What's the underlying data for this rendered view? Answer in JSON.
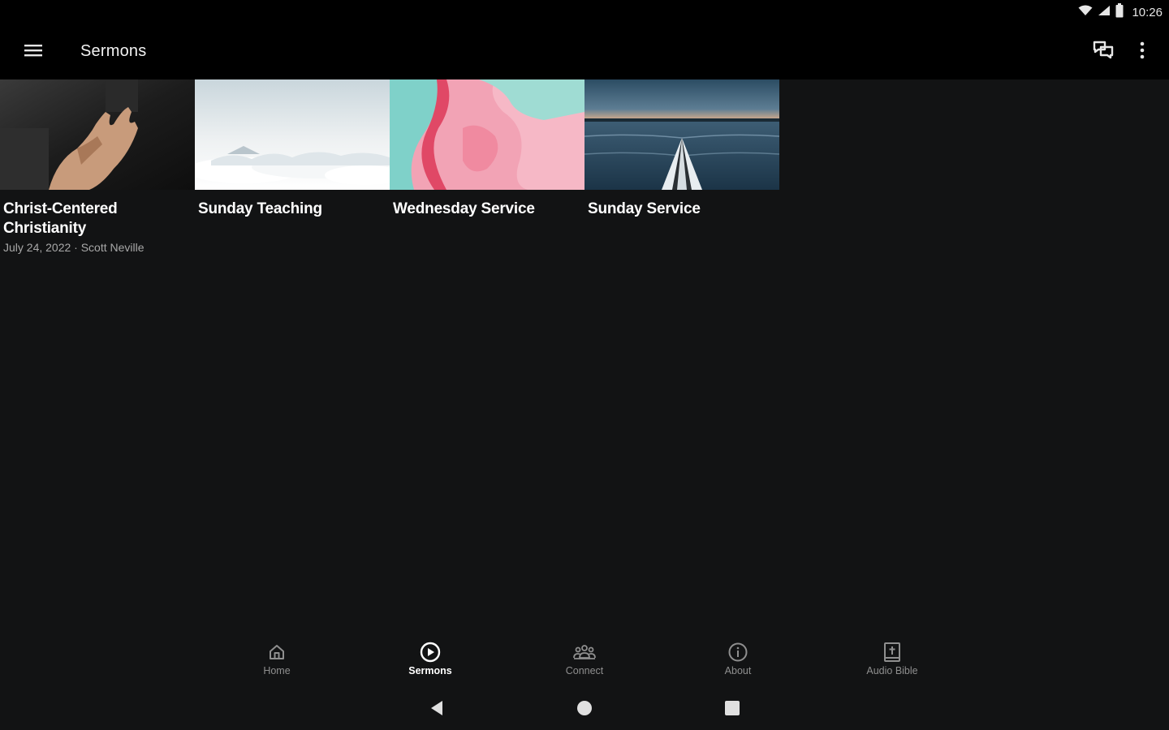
{
  "status_bar": {
    "time": "10:26",
    "icons": [
      "wifi-icon",
      "cell-signal-icon",
      "battery-icon"
    ]
  },
  "app_bar": {
    "title": "Sermons",
    "left_icon": "hamburger-menu-icon",
    "right_icons": [
      "chat-icon",
      "more-vert-icon"
    ]
  },
  "sermons": [
    {
      "title": "Christ-Centered Christianity",
      "meta": "July 24, 2022 · Scott Neville",
      "image": "open-hand-photo"
    },
    {
      "title": "Sunday Teaching",
      "meta": "",
      "image": "clouds-photo"
    },
    {
      "title": "Wednesday Service",
      "meta": "",
      "image": "pink-marble-photo"
    },
    {
      "title": "Sunday Service",
      "meta": "",
      "image": "kayak-lake-photo"
    }
  ],
  "bottom_nav": {
    "active": "Sermons",
    "items": [
      {
        "label": "Home",
        "icon": "home-icon"
      },
      {
        "label": "Sermons",
        "icon": "play-circle-icon"
      },
      {
        "label": "Connect",
        "icon": "group-icon"
      },
      {
        "label": "About",
        "icon": "info-icon"
      },
      {
        "label": "Audio Bible",
        "icon": "bible-icon"
      }
    ]
  },
  "system_nav": [
    "back-icon",
    "home-circle-icon",
    "recents-icon"
  ],
  "colors": {
    "background": "#121314",
    "bar": "#000000",
    "text_primary": "#ffffff",
    "text_secondary": "#a8a8a8",
    "nav_inactive": "#8f8f8f"
  }
}
